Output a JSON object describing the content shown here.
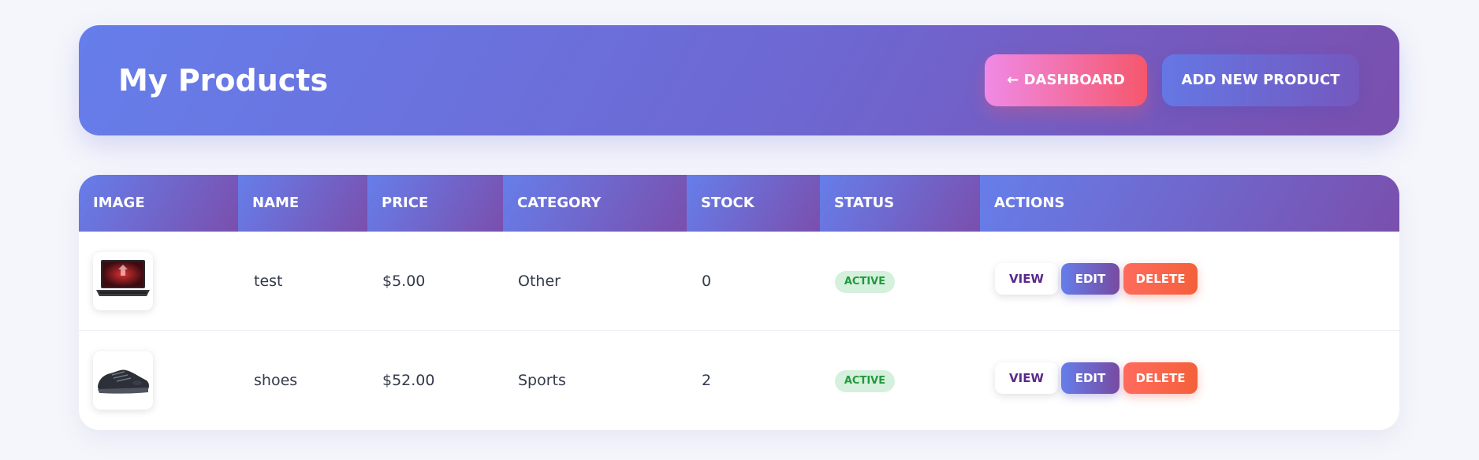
{
  "header": {
    "title": "My Products",
    "dashboard_label": "← DASHBOARD",
    "add_label": "ADD NEW PRODUCT"
  },
  "table": {
    "columns": [
      "IMAGE",
      "NAME",
      "PRICE",
      "CATEGORY",
      "STOCK",
      "STATUS",
      "ACTIONS"
    ],
    "rows": [
      {
        "image": "laptop-image",
        "name": "test",
        "price": "$5.00",
        "category": "Other",
        "stock": "0",
        "status": "ACTIVE",
        "actions": {
          "view": "VIEW",
          "edit": "EDIT",
          "delete": "DELETE"
        }
      },
      {
        "image": "sneaker-image",
        "name": "shoes",
        "price": "$52.00",
        "category": "Sports",
        "stock": "2",
        "status": "ACTIVE",
        "actions": {
          "view": "VIEW",
          "edit": "EDIT",
          "delete": "DELETE"
        }
      }
    ]
  },
  "colors": {
    "primary_gradient_start": "#667eea",
    "primary_gradient_end": "#764ba2",
    "dashboard_gradient_start": "#f093fb",
    "dashboard_gradient_end": "#f5576c",
    "delete_color": "#ff6b5d",
    "status_active_bg": "#d5f0dd",
    "status_active_text": "#22993c"
  }
}
